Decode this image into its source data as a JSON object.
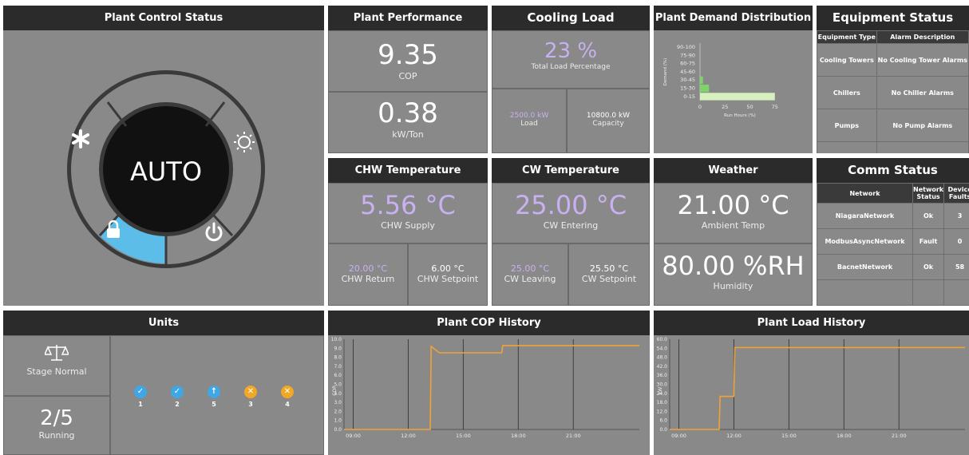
{
  "control": {
    "title": "Plant Control Status",
    "mode": "AUTO",
    "modes": [
      "cooling",
      "heating",
      "locked",
      "power"
    ]
  },
  "performance": {
    "title": "Plant Performance",
    "cop_value": "9.35",
    "cop_label": "COP",
    "kwton_value": "0.38",
    "kwton_label": "kW/Ton"
  },
  "cooling": {
    "title": "Cooling Load",
    "pct_value": "23 %",
    "pct_label": "Total Load Percentage",
    "load_value": "2500.0 kW",
    "load_label": "Load",
    "cap_value": "10800.0 kW",
    "cap_label": "Capacity"
  },
  "demand": {
    "title": "Plant Demand Distribution",
    "chart_data": {
      "type": "bar",
      "orientation": "horizontal",
      "categories": [
        "90-100",
        "75-90",
        "60-75",
        "45-60",
        "30-45",
        "15-30",
        "0-15"
      ],
      "values": [
        0,
        0,
        0,
        0,
        3,
        9,
        75
      ],
      "xlabel": "Run Hours (%)",
      "ylabel": "Demand (%)",
      "xticks": [
        "0",
        "25",
        "50",
        "75"
      ],
      "xlim": [
        0,
        80
      ],
      "colors": {
        "bar_light": "#d8f0c0",
        "bar_dark": "#7ed36a"
      }
    }
  },
  "equipment": {
    "title": "Equipment Status",
    "headers": [
      "Equipment Type",
      "Alarm Description"
    ],
    "rows": [
      [
        "Cooling Towers",
        "No Cooling Tower Alarms"
      ],
      [
        "Chillers",
        "No Chiller Alarms"
      ],
      [
        "Pumps",
        "No Pump Alarms"
      ]
    ]
  },
  "chw": {
    "title": "CHW Temperature",
    "supply_value": "5.56 °C",
    "supply_label": "CHW Supply",
    "return_value": "20.00 °C",
    "return_label": "CHW Return",
    "setpoint_value": "6.00 °C",
    "setpoint_label": "CHW Setpoint"
  },
  "cw": {
    "title": "CW Temperature",
    "entering_value": "25.00 °C",
    "entering_label": "CW Entering",
    "leaving_value": "25.00 °C",
    "leaving_label": "CW Leaving",
    "setpoint_value": "25.50 °C",
    "setpoint_label": "CW Setpoint"
  },
  "weather": {
    "title": "Weather",
    "temp_value": "21.00 °C",
    "temp_label": "Ambient Temp",
    "hum_value": "80.00 %RH",
    "hum_label": "Humidity"
  },
  "comm": {
    "title": "Comm Status",
    "headers": [
      "Network",
      "Network Status",
      "Device Faults"
    ],
    "rows": [
      [
        "NiagaraNetwork",
        "Ok",
        "3"
      ],
      [
        "ModbusAsyncNetwork",
        "Fault",
        "0"
      ],
      [
        "BacnetNetwork",
        "Ok",
        "58"
      ]
    ]
  },
  "units": {
    "title": "Units",
    "stage_label": "Stage Normal",
    "running_value": "2/5",
    "running_label": "Running",
    "items": [
      {
        "id": "1",
        "status": "ok",
        "color": "#3fa7e6"
      },
      {
        "id": "2",
        "status": "ok",
        "color": "#3fa7e6"
      },
      {
        "id": "5",
        "status": "up",
        "color": "#3fa7e6"
      },
      {
        "id": "3",
        "status": "fault",
        "color": "#f0a825"
      },
      {
        "id": "4",
        "status": "fault",
        "color": "#f0a825"
      }
    ]
  },
  "cop_history": {
    "title": "Plant COP History",
    "chart_data": {
      "type": "line",
      "ylabel": "COP",
      "ylim": [
        0,
        10
      ],
      "yticks": [
        "0.0",
        "1.0",
        "2.0",
        "3.0",
        "4.0",
        "5.0",
        "6.0",
        "7.0",
        "8.0",
        "9.0",
        "10.0"
      ],
      "xticks": [
        "09:00",
        "12:00",
        "15:00",
        "18:00",
        "21:00"
      ],
      "x": [
        8.5,
        13.2,
        13.25,
        13.7,
        17.1,
        17.15,
        24.6
      ],
      "y": [
        0,
        0,
        9.2,
        8.5,
        8.5,
        9.3,
        9.3
      ],
      "color": "#f0a23a"
    }
  },
  "load_history": {
    "title": "Plant Load History",
    "chart_data": {
      "type": "line",
      "ylabel": "kW",
      "ylim": [
        0,
        60
      ],
      "yticks": [
        "0.0",
        "6.0",
        "12.0",
        "18.0",
        "24.0",
        "30.0",
        "36.0",
        "42.0",
        "48.0",
        "54.0",
        "60.0"
      ],
      "xticks": [
        "09:00",
        "12:00",
        "15:00",
        "18:00",
        "21:00"
      ],
      "x": [
        8.5,
        11.2,
        11.25,
        12.0,
        12.05,
        24.6
      ],
      "y": [
        0,
        0,
        22,
        22,
        54.5,
        54.5
      ],
      "color": "#f0a23a"
    }
  }
}
